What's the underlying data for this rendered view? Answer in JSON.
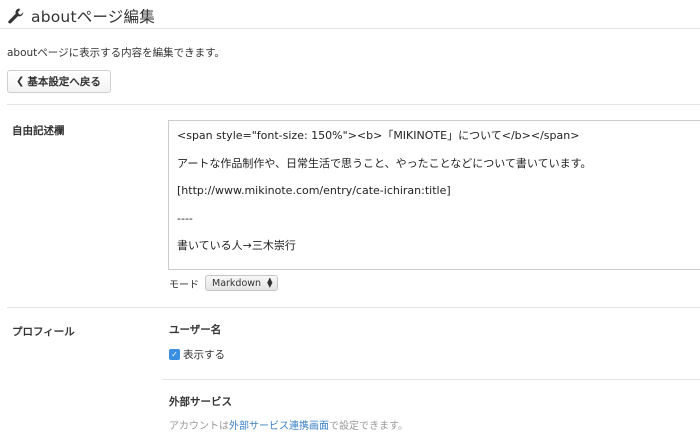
{
  "header": {
    "icon": "wrench-icon",
    "title": "aboutページ編集"
  },
  "description": "aboutページに表示する内容を編集できます。",
  "back_button": {
    "icon": "chevron-left-icon",
    "label": "基本設定へ戻る"
  },
  "free_text": {
    "label": "自由記述欄",
    "lines": [
      "<span style=\"font-size: 150%\"><b>「MIKINOTE」について</b></span>",
      "アートな作品制作や、日常生活で思うこと、やったことなどについて書いています。",
      "[http://www.mikinote.com/entry/cate-ichiran:title]",
      "----",
      "書いている人→三木崇行"
    ],
    "mode_label": "モード",
    "mode_value": "Markdown"
  },
  "profile": {
    "label": "プロフィール",
    "username_heading": "ユーザー名",
    "show_checkbox_label": "表示する",
    "show_checked": true,
    "external_heading": "外部サービス",
    "note_prefix": "アカウントは",
    "note_link": "外部サービス連携画面",
    "note_suffix": "で設定できます。"
  },
  "colors": {
    "checkbox": "#3b8fe0",
    "link": "#3b7fc4",
    "divider": "#e4e4e4"
  }
}
